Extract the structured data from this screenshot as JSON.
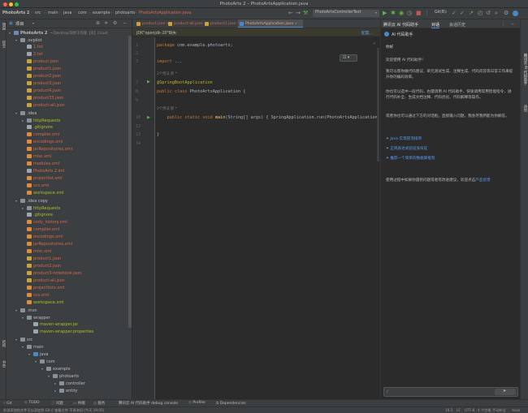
{
  "window": {
    "title": "PhotoArts 2 – PhotoArtsApplication.java"
  },
  "breadcrumbs": [
    "PhotoArts 2",
    "src",
    "main",
    "java",
    "com",
    "example",
    "photoarts",
    "PhotoArtsApplication.java"
  ],
  "toolbar": {
    "run_config": "PhotoArtsControllerTest",
    "git_label": "Git(B):"
  },
  "project": {
    "header": "项目",
    "tree": [
      {
        "label": "PhotoArts 2",
        "extra": "~/Desktop/同步工作盘【京】Cloud",
        "depth": 0,
        "kind": "module",
        "open": true,
        "color": "#bbbbbb"
      },
      {
        "label": ".ovpilot",
        "depth": 1,
        "kind": "folder",
        "open": true,
        "color": "#bbbbbb"
      },
      {
        "label": "1.txt",
        "depth": 2,
        "kind": "file",
        "color": "#d4694a"
      },
      {
        "label": "2.txt",
        "depth": 2,
        "kind": "file",
        "color": "#d4694a"
      },
      {
        "label": "product.json",
        "depth": 2,
        "kind": "json",
        "color": "#d4694a"
      },
      {
        "label": "product1.json",
        "depth": 2,
        "kind": "json",
        "color": "#d4694a"
      },
      {
        "label": "product2.json",
        "depth": 2,
        "kind": "json",
        "color": "#d4694a"
      },
      {
        "label": "product3.json",
        "depth": 2,
        "kind": "json",
        "color": "#d4694a"
      },
      {
        "label": "product4.json",
        "depth": 2,
        "kind": "json",
        "color": "#d4694a"
      },
      {
        "label": "product33.json",
        "depth": 2,
        "kind": "json",
        "color": "#d4694a"
      },
      {
        "label": "product-all.json",
        "depth": 2,
        "kind": "json",
        "color": "#d4694a"
      },
      {
        "label": ".idea",
        "depth": 1,
        "kind": "folder",
        "open": true,
        "color": "#bbbbbb"
      },
      {
        "label": "httpRequests",
        "depth": 2,
        "kind": "folder",
        "open": false,
        "color": "#a8c023"
      },
      {
        "label": ".gitignore",
        "depth": 2,
        "kind": "file",
        "color": "#a8c023"
      },
      {
        "label": "compiler.xml",
        "depth": 2,
        "kind": "xml",
        "color": "#d4694a"
      },
      {
        "label": "encodings.xml",
        "depth": 2,
        "kind": "xml",
        "color": "#d4694a"
      },
      {
        "label": "jarRepositories.xml",
        "depth": 2,
        "kind": "xml",
        "color": "#d4694a"
      },
      {
        "label": "misc.xml",
        "depth": 2,
        "kind": "xml",
        "color": "#d4694a"
      },
      {
        "label": "modules.xml",
        "depth": 2,
        "kind": "xml",
        "color": "#d4694a"
      },
      {
        "label": "PhotoArts 2.iml",
        "depth": 2,
        "kind": "file",
        "color": "#d4694a"
      },
      {
        "label": "projectlist.xml",
        "depth": 2,
        "kind": "xml",
        "color": "#d4694a"
      },
      {
        "label": "vcs.xml",
        "depth": 2,
        "kind": "xml",
        "color": "#d4694a"
      },
      {
        "label": "workspace.xml",
        "depth": 2,
        "kind": "xml",
        "color": "#a8c023"
      },
      {
        "label": ".idea copy",
        "depth": 1,
        "kind": "folder",
        "open": true,
        "color": "#bbbbbb"
      },
      {
        "label": "httpRequests",
        "depth": 2,
        "kind": "folder",
        "open": false,
        "color": "#a8c023"
      },
      {
        "label": ".gitignore",
        "depth": 2,
        "kind": "file",
        "color": "#a8c023"
      },
      {
        "label": "cody_history.xml",
        "depth": 2,
        "kind": "xml",
        "color": "#d4694a"
      },
      {
        "label": "compiler.xml",
        "depth": 2,
        "kind": "xml",
        "color": "#d4694a"
      },
      {
        "label": "encodings.xml",
        "depth": 2,
        "kind": "xml",
        "color": "#d4694a"
      },
      {
        "label": "jarRepositories.xml",
        "depth": 2,
        "kind": "xml",
        "color": "#d4694a"
      },
      {
        "label": "misc.xml",
        "depth": 2,
        "kind": "xml",
        "color": "#d4694a"
      },
      {
        "label": "product1.json",
        "depth": 2,
        "kind": "json",
        "color": "#d4694a"
      },
      {
        "label": "product2.json",
        "depth": 2,
        "kind": "json",
        "color": "#d4694a"
      },
      {
        "label": "product3-notebook.json",
        "depth": 2,
        "kind": "json",
        "color": "#d4694a"
      },
      {
        "label": "product-all.json",
        "depth": 2,
        "kind": "json",
        "color": "#d4694a"
      },
      {
        "label": "projectlistx.xml",
        "depth": 2,
        "kind": "xml",
        "color": "#d4694a"
      },
      {
        "label": "vcs.xml",
        "depth": 2,
        "kind": "xml",
        "color": "#d4694a"
      },
      {
        "label": "workspace.xml",
        "depth": 2,
        "kind": "xml",
        "color": "#a8c023"
      },
      {
        "label": ".mvn",
        "depth": 1,
        "kind": "folder",
        "open": true,
        "color": "#bbbbbb"
      },
      {
        "label": "wrapper",
        "depth": 2,
        "kind": "folder",
        "open": true,
        "color": "#bbbbbb"
      },
      {
        "label": "maven-wrapper.jar",
        "depth": 3,
        "kind": "file",
        "color": "#a8c023"
      },
      {
        "label": "maven-wrapper.properties",
        "depth": 3,
        "kind": "file",
        "color": "#a8c023"
      },
      {
        "label": "src",
        "depth": 1,
        "kind": "folder",
        "open": true,
        "color": "#bbbbbb"
      },
      {
        "label": "main",
        "depth": 2,
        "kind": "folder",
        "open": true,
        "color": "#bbbbbb"
      },
      {
        "label": "java",
        "depth": 3,
        "kind": "srcfolder",
        "open": true,
        "color": "#bbbbbb"
      },
      {
        "label": "com",
        "depth": 4,
        "kind": "folder",
        "open": true,
        "color": "#bbbbbb"
      },
      {
        "label": "example",
        "depth": 5,
        "kind": "folder",
        "open": true,
        "color": "#bbbbbb"
      },
      {
        "label": "photoarts",
        "depth": 6,
        "kind": "folder",
        "open": true,
        "color": "#bbbbbb"
      },
      {
        "label": "controller",
        "depth": 7,
        "kind": "folder",
        "open": false,
        "color": "#bbbbbb"
      },
      {
        "label": "entity",
        "depth": 7,
        "kind": "folder",
        "open": false,
        "color": "#bbbbbb"
      }
    ]
  },
  "editor": {
    "tabs": [
      {
        "label": "product.json",
        "active": false
      },
      {
        "label": "product-all.json",
        "active": false
      },
      {
        "label": "product1.json",
        "active": false
      },
      {
        "label": "PhotoArtsApplication.java",
        "active": true
      }
    ],
    "jdk_warning": "JDK\"openjdk-20\"缺失",
    "jdk_action": "配置...",
    "code": [
      {
        "ln": "1",
        "segments": [
          {
            "t": "package ",
            "c": "#cc7832"
          },
          {
            "t": "com.example.photoarts;",
            "c": "#a9b7c6"
          }
        ]
      },
      {
        "ln": "2",
        "segments": []
      },
      {
        "ln": "3",
        "segments": [
          {
            "t": "import ",
            "c": "#cc7832"
          },
          {
            "t": "...",
            "c": "#a9b7c6"
          }
        ]
      },
      {
        "ln": "",
        "hint": "2个用法  新 *"
      },
      {
        "ln": "7",
        "segments": [
          {
            "t": "@SpringBootApplication",
            "c": "#bbb529"
          }
        ]
      },
      {
        "ln": "8",
        "segments": [
          {
            "t": "public class ",
            "c": "#cc7832"
          },
          {
            "t": "PhotoArtsApplication {",
            "c": "#a9b7c6"
          }
        ]
      },
      {
        "ln": "9",
        "segments": []
      },
      {
        "ln": "",
        "hint": "0个用法  新 *"
      },
      {
        "ln": "10",
        "segments": [
          {
            "t": "    public static void ",
            "c": "#cc7832"
          },
          {
            "t": "main",
            "c": "#ffc66d"
          },
          {
            "t": "(String[] args) { SpringApplication.",
            "c": "#a9b7c6"
          },
          {
            "t": "run",
            "c": "#a9b7c6"
          },
          {
            "t": "(PhotoArtsApplication.",
            "c": "#a9b7c6"
          }
        ]
      },
      {
        "ln": "12",
        "segments": []
      },
      {
        "ln": "13",
        "segments": [
          {
            "t": "}",
            "c": "#a9b7c6"
          }
        ]
      },
      {
        "ln": "14",
        "segments": []
      }
    ]
  },
  "ai": {
    "tabs": [
      "腾讯云 AI 代码助手",
      "对话",
      "会话历史"
    ],
    "header": "AI 代码助手",
    "greeting": "你好",
    "welcome": "欢迎使用 AI 代码助手!",
    "p1": "我可以帮你做代码建议、单元测试生成、注释生成、代码问答等日常工作来提升你的编码效率。",
    "p2": "你也可以选中一段代码，右键调用 AI 代码助手，快速调用常用智能指令，进行代码补全、生成文档注释、代码优化、代码解释等操作。",
    "p3": "或者你也可以通过下方的对话框，直接输入问题，我会尽我所能为你解答。",
    "links": [
      "Java 实现冒泡排序",
      "正则表达式验证身份证",
      "推荐一个简单的数据库框架"
    ],
    "footer_text": "使用过程中如果你遇到问题或者有改进建议，欢迎点击",
    "footer_link": "产品反馈",
    "input_placeholder": "/"
  },
  "bottom_tools": [
    "Git",
    "TODO",
    "问题",
    "终端",
    "服务",
    "腾讯云 AI 代码助手 debug console",
    "Profiler",
    "Dependencies"
  ],
  "statusbar": {
    "left": "外部添加的文件可以添加到 Git // 查看文件    不再询问 (今天 19:05)",
    "right": [
      "16:1",
      "LF",
      "UTF-8",
      "4 个空格",
      "手动补全",
      "main"
    ]
  },
  "left_strip": [
    "项目",
    "提交",
    "结构",
    "书签"
  ],
  "right_strip": [
    "腾讯云 AI 代码助手",
    "通知"
  ],
  "colors": {
    "accent": "#4a88c7",
    "modified": "#d4694a",
    "added": "#a8c023"
  }
}
